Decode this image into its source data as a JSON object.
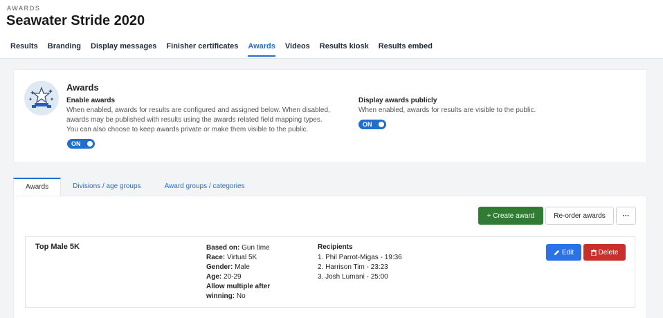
{
  "header": {
    "eyebrow": "AWARDS",
    "title": "Seawater Stride 2020",
    "nav": [
      "Results",
      "Branding",
      "Display messages",
      "Finisher certificates",
      "Awards",
      "Videos",
      "Results kiosk",
      "Results embed"
    ],
    "active_nav": "Awards"
  },
  "settings": {
    "heading": "Awards",
    "enable": {
      "label": "Enable awards",
      "desc1": "When enabled, awards for results are configured and assigned below. When disabled,",
      "desc2": "awards may be published with results using the awards related field mapping types.",
      "desc3": "You can also choose to keep awards private or make them visible to the public.",
      "toggle": "ON"
    },
    "public": {
      "label": "Display awards publicly",
      "desc1": "When enabled, awards for results are visible to the public.",
      "toggle": "ON"
    }
  },
  "tabs": [
    "Awards",
    "Divisions / age groups",
    "Award groups / categories"
  ],
  "toolbar": {
    "create": "+ Create award",
    "reorder": "Re-order awards",
    "more": "···"
  },
  "award": {
    "name": "Top Male 5K",
    "based_on_label": "Based on:",
    "based_on": "Gun time",
    "race_label": "Race:",
    "race": "Virtual 5K",
    "gender_label": "Gender:",
    "gender": "Male",
    "age_label": "Age:",
    "age": "20-29",
    "multi_label1": "Allow multiple after",
    "multi_label2": "winning:",
    "multi": "No",
    "recipients_label": "Recipients",
    "recipients": [
      "1. Phil Parrot-Migas - 19:36",
      "2. Harrison Tim - 23:23",
      "3. Josh Lumani - 25:00"
    ],
    "edit": "Edit",
    "delete": "Delete"
  },
  "colors": {
    "primary": "#1f6fd1",
    "success": "#2e7d32",
    "danger": "#c9302c",
    "edit": "#2a72e6"
  }
}
